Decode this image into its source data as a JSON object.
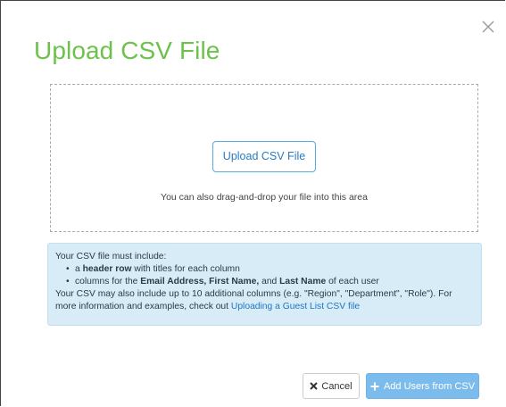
{
  "dialog": {
    "title": "Upload CSV File",
    "close_icon": "close-icon"
  },
  "dropzone": {
    "button_label": "Upload CSV File",
    "hint": "You can also drag-and-drop your file into this area"
  },
  "info": {
    "intro": "Your CSV file must include:",
    "bullets": [
      {
        "a": "a ",
        "b": "header row",
        "c": " with titles for each column"
      },
      {
        "a": "columns for the ",
        "b1": "Email Address, First Name,",
        "mid": " and ",
        "b2": "Last Name",
        "c": " of each user"
      }
    ],
    "more_text": "Your CSV may also include up to 10 additional columns (e.g. \"Region\", \"Department\", \"Role\"). For more information and examples, check out ",
    "link_text": "Uploading a Guest List CSV file"
  },
  "footer": {
    "cancel_label": "Cancel",
    "cancel_icon": "x-icon",
    "add_label": "Add Users from CSV",
    "add_icon": "plus-icon"
  },
  "colors": {
    "title": "#6cc24a",
    "accent": "#5aa9e0",
    "info_bg": "#d8ecf7",
    "primary_button": "#7cbcec"
  }
}
